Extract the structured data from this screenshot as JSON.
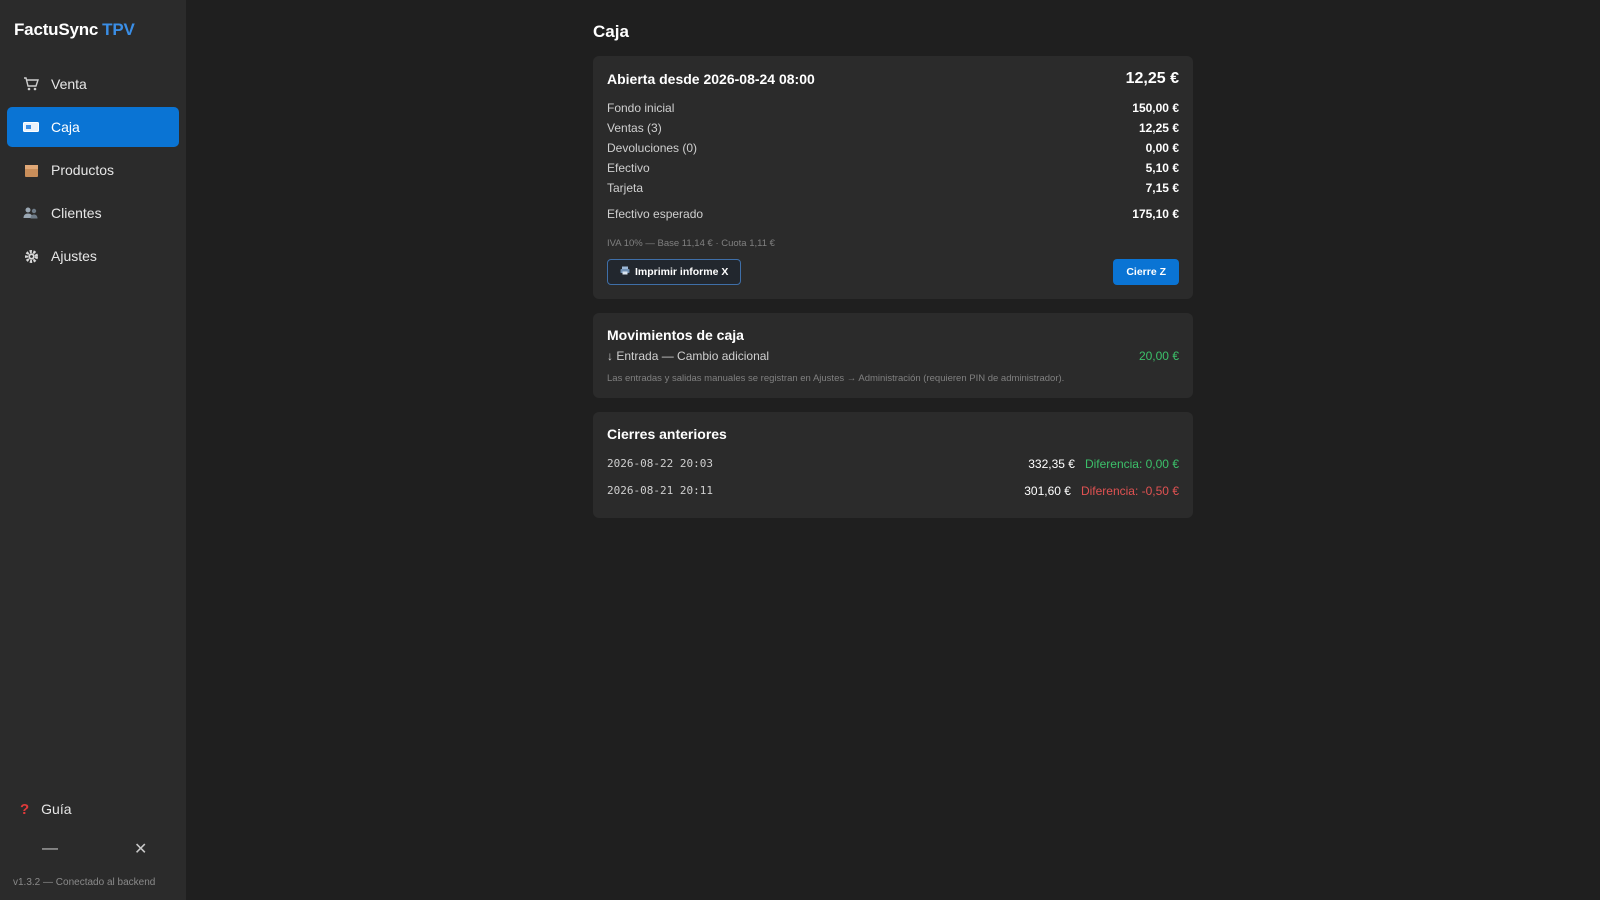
{
  "app": {
    "name": "FactuSync",
    "suffix": "TPV"
  },
  "sidebar": {
    "items": [
      {
        "label": "Venta",
        "icon": "cart-icon",
        "active": false
      },
      {
        "label": "Caja",
        "icon": "cash-register-icon",
        "active": true
      },
      {
        "label": "Productos",
        "icon": "box-icon",
        "active": false
      },
      {
        "label": "Clientes",
        "icon": "users-icon",
        "active": false
      },
      {
        "label": "Ajustes",
        "icon": "gear-icon",
        "active": false
      }
    ],
    "guide": {
      "label": "Guía",
      "icon": "question-icon"
    },
    "window_controls": {
      "minimize": "—",
      "close": "✕"
    },
    "version": "v1.3.2 — Conectado al backend"
  },
  "page": {
    "title": "Caja"
  },
  "session": {
    "title": "Abierta desde 2026-08-24 08:00",
    "total": "12,25 €",
    "rows": [
      {
        "label": "Fondo inicial",
        "value": "150,00 €"
      },
      {
        "label": "Ventas (3)",
        "value": "12,25 €"
      },
      {
        "label": "Devoluciones (0)",
        "value": "0,00 €"
      },
      {
        "label": "Efectivo",
        "value": "5,10 €"
      },
      {
        "label": "Tarjeta",
        "value": "7,15 €"
      }
    ],
    "expected": {
      "label": "Efectivo esperado",
      "value": "175,10 €"
    },
    "tax_note": "IVA 10% — Base 11,14 € · Cuota 1,11 €",
    "print_button": "Imprimir informe X",
    "close_button": "Cierre Z"
  },
  "movements": {
    "title": "Movimientos de caja",
    "items": [
      {
        "label": "↓ Entrada — Cambio adicional",
        "amount": "20,00 €"
      }
    ],
    "note": "Las entradas y salidas manuales se registran en Ajustes → Administración (requieren PIN de administrador)."
  },
  "closures": {
    "title": "Cierres anteriores",
    "items": [
      {
        "date": "2026-08-22 20:03",
        "amount": "332,35 €",
        "difference": "Diferencia: 0,00 €",
        "status": "ok"
      },
      {
        "date": "2026-08-21 20:11",
        "amount": "301,60 €",
        "difference": "Diferencia: -0,50 €",
        "status": "negative"
      }
    ]
  },
  "colors": {
    "accent": "#0a74d4",
    "positive": "#3cc06a",
    "negative": "#e05252"
  }
}
